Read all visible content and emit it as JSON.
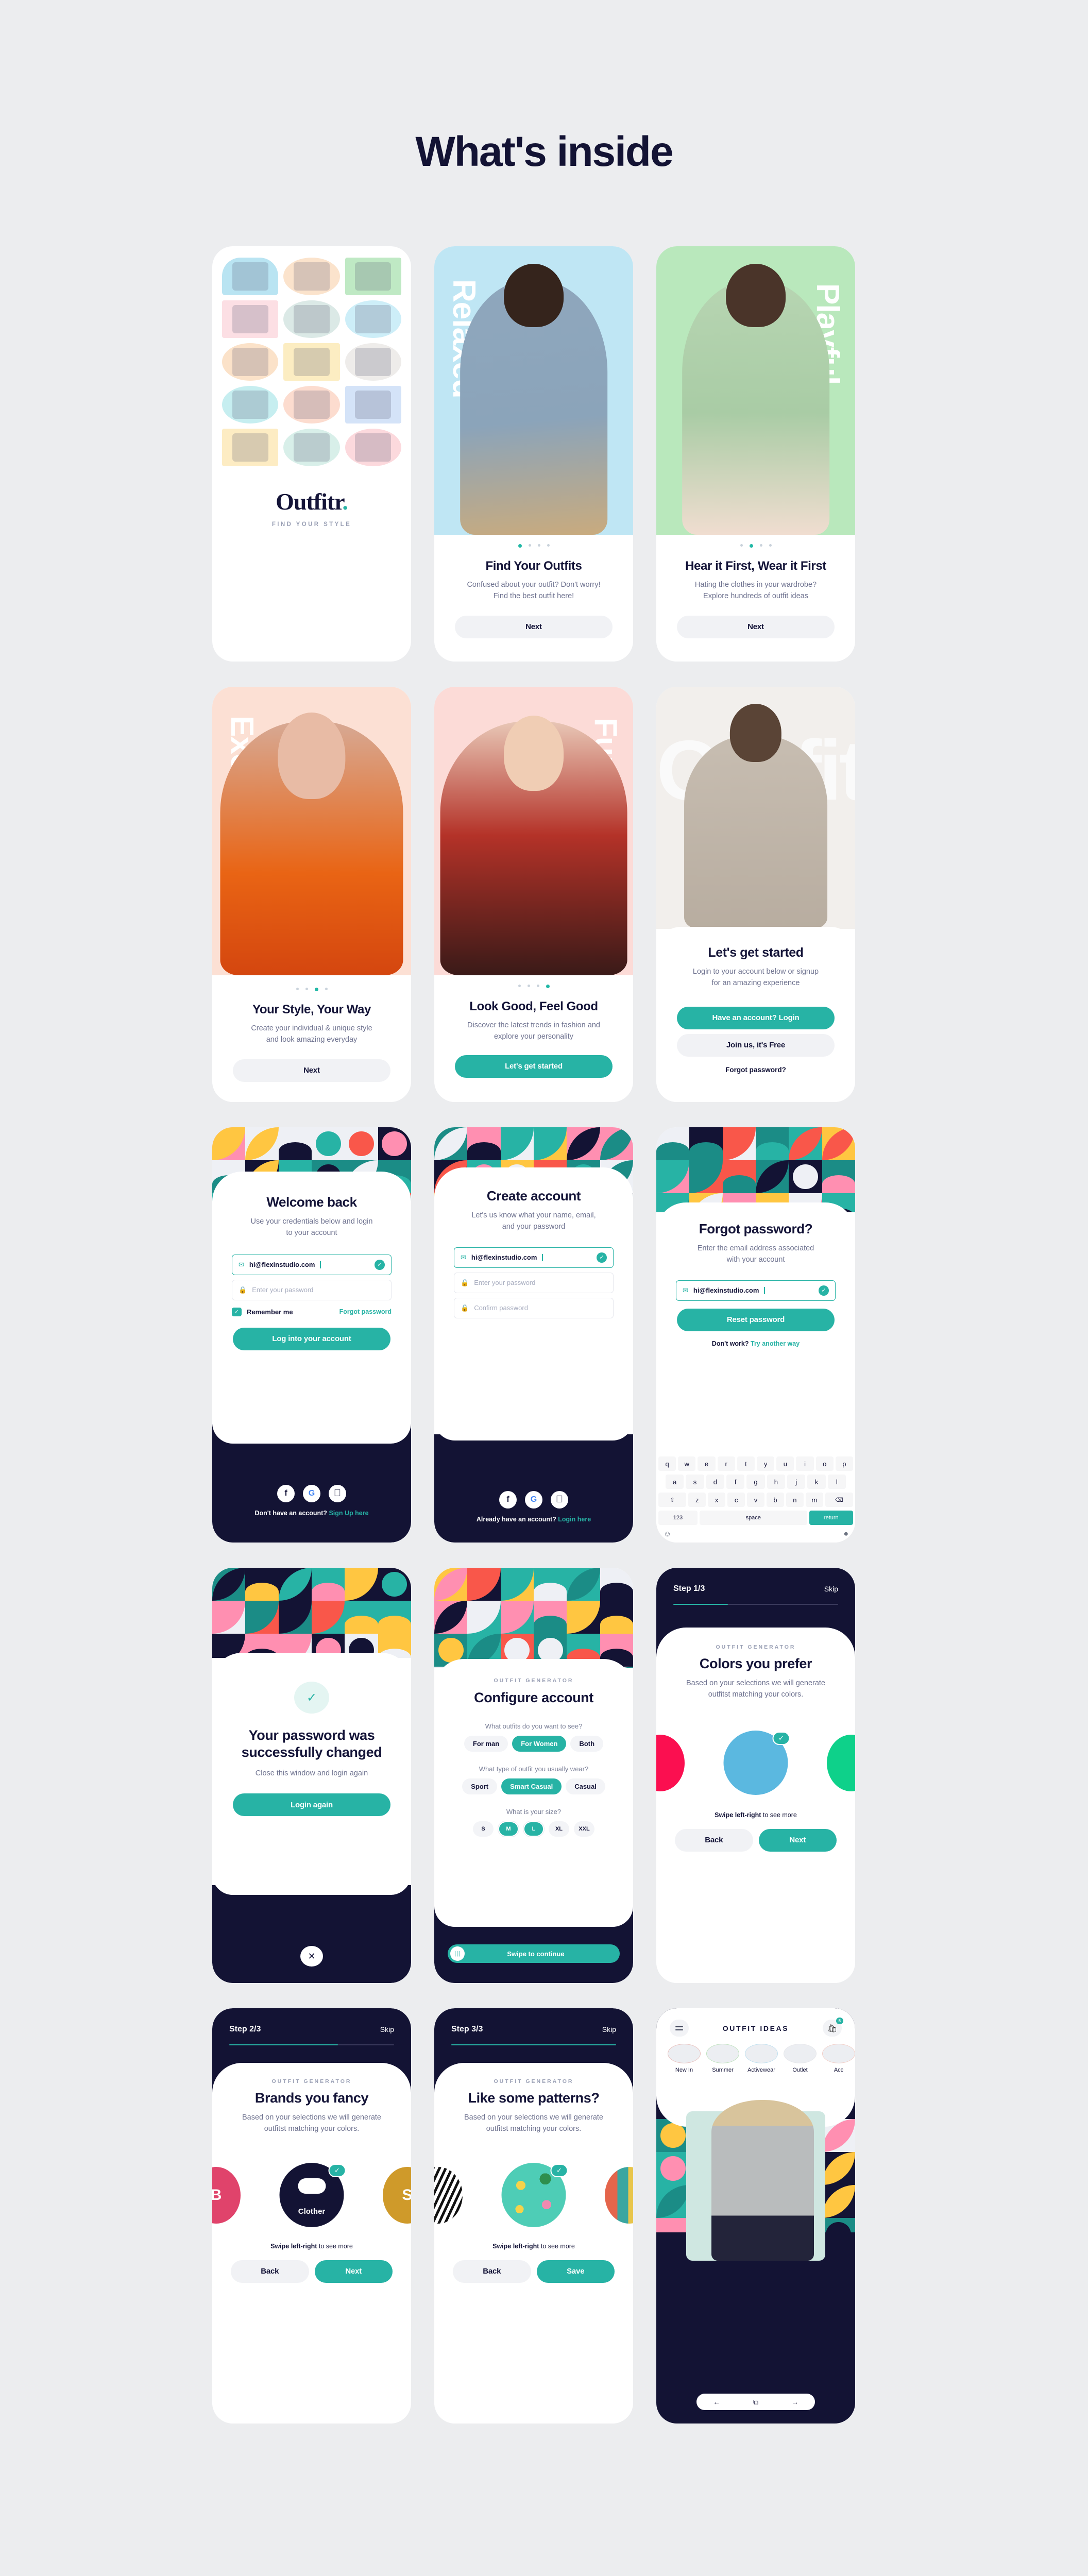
{
  "page": {
    "title": "What's inside"
  },
  "theme": {
    "teal": "#27b3a5",
    "navy": "#131334",
    "bg": "#ecedef",
    "muted": "#6f7390"
  },
  "cards": {
    "splash": {
      "logo": "Outfitr",
      "logo_dot": ".",
      "tagline": "FIND YOUR STYLE",
      "tiles": [
        {
          "name": "tile-man-blue-shirt",
          "bg": "#b9e4f2",
          "shape": "bl"
        },
        {
          "name": "tile-straw-hat",
          "bg": "#fbe3cc",
          "shape": "el"
        },
        {
          "name": "tile-woman-green-top",
          "bg": "#bfe9c4",
          "shape": "sq"
        },
        {
          "name": "tile-pink-slides",
          "bg": "#fcdfe4",
          "shape": "sq"
        },
        {
          "name": "tile-man-denim",
          "bg": "#dbe9e6",
          "shape": "el"
        },
        {
          "name": "tile-sunglasses",
          "bg": "#cdeef8",
          "shape": "el"
        },
        {
          "name": "tile-peach-tee",
          "bg": "#fbe2c9",
          "shape": "el"
        },
        {
          "name": "tile-handbag",
          "bg": "#fcedc2",
          "shape": "sq"
        },
        {
          "name": "tile-man-glasses",
          "bg": "#eeecea",
          "shape": "el"
        },
        {
          "name": "tile-duffel-bag",
          "bg": "#c6eef0",
          "shape": "el"
        },
        {
          "name": "tile-woman-teal-hair",
          "bg": "#fcdccf",
          "shape": "el"
        },
        {
          "name": "tile-sneakers",
          "bg": "#d4e3f8",
          "shape": "sq"
        },
        {
          "name": "tile-yellow-puffer",
          "bg": "#fdecc3",
          "shape": "sq"
        },
        {
          "name": "tile-heel-shoe",
          "bg": "#d8efe9",
          "shape": "el"
        },
        {
          "name": "tile-woman-scarf",
          "bg": "#fcd9dd",
          "shape": "el"
        }
      ]
    },
    "onboard1": {
      "sideword": "Relaxed",
      "bg": "#bfe6f4",
      "dots": [
        true,
        false,
        false,
        false
      ],
      "title": "Find Your Outfits",
      "subtitle_line1": "Confused about your outfit? Don't worry!",
      "subtitle_line2": "Find the best outfit here!",
      "button": "Next"
    },
    "onboard2": {
      "sideword": "Playful",
      "bg": "#b9e8bc",
      "dots": [
        false,
        true,
        false,
        false
      ],
      "title": "Hear it First, Wear it First",
      "subtitle_line1": "Hating the clothes in your wardrobe?",
      "subtitle_line2": "Explore hundreds of outfit ideas",
      "button": "Next"
    },
    "onboard3": {
      "sideword": "Excentric",
      "bg": "#fce0d4",
      "dots": [
        false,
        false,
        true,
        false
      ],
      "title": "Your Style, Your Way",
      "subtitle_line1": "Create your individual & unique style",
      "subtitle_line2": "and look amazing everyday",
      "button": "Next"
    },
    "onboard4": {
      "sideword": "Funky",
      "bg": "#fcdbd7",
      "dots": [
        false,
        false,
        false,
        true
      ],
      "title": "Look Good, Feel Good",
      "subtitle_line1": "Discover the latest trends in fashion and",
      "subtitle_line2": "explore your personality",
      "button": "Let's get started"
    },
    "getstarted": {
      "watermark": "Outfitr",
      "title": "Let's get started",
      "subtitle_line1": "Login to your account below or signup",
      "subtitle_line2": "for an amazing experience",
      "primary_button": "Have an account? Login",
      "secondary_button": "Join us, it's Free",
      "link": "Forgot password?"
    },
    "login": {
      "title": "Welcome back",
      "subtitle_line1": "Use your credentials below and login",
      "subtitle_line2": "to your account",
      "email_value": "hi@flexinstudio.com",
      "password_placeholder": "Enter your password",
      "remember_label": "Remember me",
      "forgot_link": "Forgot password",
      "submit_button": "Log into your account",
      "socials": [
        "facebook-icon",
        "google-icon",
        "apple-icon"
      ],
      "footer_text": "Don't have an account?",
      "footer_link": "Sign Up here"
    },
    "signup": {
      "title": "Create account",
      "subtitle_line1": "Let's us know what your name, email,",
      "subtitle_line2": "and your password",
      "email_value": "hi@flexinstudio.com",
      "password_placeholder": "Enter your password",
      "confirm_placeholder": "Confirm password",
      "socials": [
        "facebook-icon",
        "google-icon",
        "apple-icon"
      ],
      "footer_text": "Already have an account?",
      "footer_link": "Login here"
    },
    "forgot": {
      "title": "Forgot password?",
      "subtitle_line1": "Enter the email address associated",
      "subtitle_line2": "with your account",
      "email_value": "hi@flexinstudio.com",
      "submit_button": "Reset password",
      "help_text": "Don't work?",
      "help_link": "Try another way",
      "keyboard": {
        "row1": [
          "q",
          "w",
          "e",
          "r",
          "t",
          "y",
          "u",
          "i",
          "o",
          "p"
        ],
        "row2": [
          "a",
          "s",
          "d",
          "f",
          "g",
          "h",
          "j",
          "k",
          "l"
        ],
        "row3_shift": "⇧",
        "row3": [
          "z",
          "x",
          "c",
          "v",
          "b",
          "n",
          "m"
        ],
        "row3_backspace": "⌫",
        "numbers": "123",
        "space": "space",
        "return": "return",
        "emoji": "☺",
        "mic": "🎤"
      }
    },
    "success": {
      "check_icon": "✓",
      "title_line1": "Your password was",
      "title_line2": "successfully changed",
      "subtitle": "Close this window and login again",
      "button": "Login again",
      "close_icon": "✕"
    },
    "configure": {
      "eyebrow": "OUTFIT GENERATOR",
      "title": "Configure account",
      "q1": "What outfits do you want to see?",
      "q1_options": [
        {
          "label": "For man",
          "selected": false
        },
        {
          "label": "For Women",
          "selected": true
        },
        {
          "label": "Both",
          "selected": false
        }
      ],
      "q2": "What type of outfit you usually wear?",
      "q2_options": [
        {
          "label": "Sport",
          "selected": false
        },
        {
          "label": "Smart Casual",
          "selected": true
        },
        {
          "label": "Casual",
          "selected": false
        }
      ],
      "q3": "What is your size?",
      "q3_options": [
        {
          "label": "S",
          "selected": false
        },
        {
          "label": "M",
          "selected": true
        },
        {
          "label": "L",
          "selected": true
        },
        {
          "label": "XL",
          "selected": false
        },
        {
          "label": "XXL",
          "selected": false
        }
      ],
      "swipe_button": "Swipe to continue"
    },
    "step1": {
      "step_label": "Step 1/3",
      "skip": "Skip",
      "progress": 33,
      "eyebrow": "OUTFIT GENERATOR",
      "title": "Colors you prefer",
      "subtitle_line1": "Based on your selections we will generate",
      "subtitle_line2": "outfitst matching your colors.",
      "swipe_bold": "Swipe left-right",
      "swipe_rest": " to see more",
      "colors": [
        "#fb0f50",
        "#5bb8e0",
        "#0ed18a"
      ],
      "selected_color": "#5bb8e0",
      "check_icon": "✓",
      "back_button": "Back",
      "next_button": "Next"
    },
    "step2": {
      "step_label": "Step 2/3",
      "skip": "Skip",
      "progress": 66,
      "eyebrow": "OUTFIT GENERATOR",
      "title": "Brands you fancy",
      "subtitle_line1": "Based on your selections we will generate",
      "subtitle_line2": "outfitst matching your colors.",
      "swipe_bold": "Swipe left-right",
      "swipe_rest": " to see more",
      "brands": [
        {
          "name": "B",
          "color": "#e0436b"
        },
        {
          "name": "Clother",
          "color": "#131334"
        },
        {
          "name": "S",
          "color": "#cf9a2a"
        }
      ],
      "selected_brand": "Clother",
      "check_icon": "✓",
      "back_button": "Back",
      "next_button": "Next"
    },
    "step3": {
      "step_label": "Step 3/3",
      "skip": "Skip",
      "progress": 100,
      "eyebrow": "OUTFIT GENERATOR",
      "title": "Like some patterns?",
      "subtitle_line1": "Based on your selections we will generate",
      "subtitle_line2": "outfitst matching your colors.",
      "swipe_bold": "Swipe left-right",
      "swipe_rest": " to see more",
      "patterns": [
        "zebra-stripes",
        "tropical-pineapple",
        "color-blocks"
      ],
      "selected_pattern": "tropical-pineapple",
      "check_icon": "✓",
      "back_button": "Back",
      "save_button": "Save"
    },
    "outfitideas": {
      "header_title": "OUTFIT IDEAS",
      "menu_icon": "hamburger-icon",
      "bag_icon": "shopping-bag-icon",
      "bag_count": "5",
      "categories": [
        "New In",
        "Summer",
        "Activewear",
        "Outlet",
        "Acc"
      ],
      "nav_prev": "←",
      "nav_share": "⧉",
      "nav_next": "→"
    }
  }
}
